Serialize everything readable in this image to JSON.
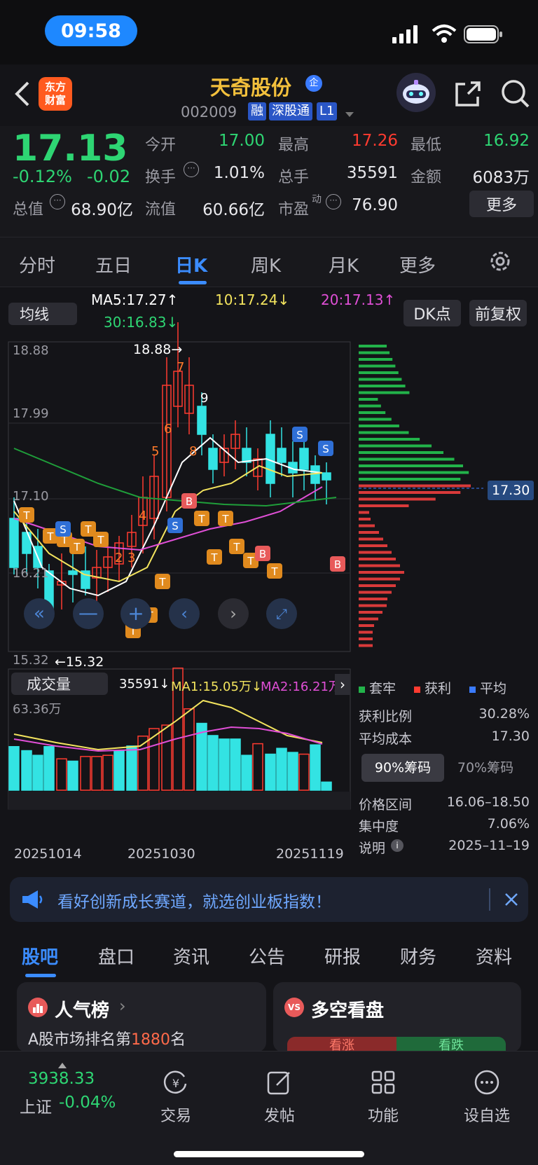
{
  "status": {
    "time": "09:58"
  },
  "header": {
    "name": "天奇股份",
    "code": "002009",
    "tags": [
      "融",
      "深股通",
      "L1"
    ],
    "name_badge": "企"
  },
  "quote": {
    "price": "17.13",
    "pct": "-0.12%",
    "chg": "-0.02",
    "open_label": "今开",
    "open": "17.00",
    "high_label": "最高",
    "high": "17.26",
    "low_label": "最低",
    "low": "16.92",
    "turnover_label": "换手",
    "turnover": "1.01%",
    "vol_label": "总手",
    "vol": "35591",
    "amt_label": "金额",
    "amt": "6083万",
    "mcap_label": "总值",
    "mcap": "68.90亿",
    "float_label": "流值",
    "float": "60.66亿",
    "pe_label": "市盈",
    "pe_sup": "动",
    "pe": "76.90",
    "more": "更多"
  },
  "period_tabs": [
    "分时",
    "五日",
    "日K",
    "周K",
    "月K",
    "更多"
  ],
  "period_active": 2,
  "ma": {
    "selector": "均线",
    "ma5": "MA5:17.27↑",
    "ma10": "10:17.24↓",
    "ma20": "20:17.13↑",
    "ma30": "30:16.83↓",
    "dk": "DK点",
    "fq": "前复权"
  },
  "kline": {
    "y_labels": [
      "18.88",
      "17.99",
      "17.10",
      "16.21",
      "15.32"
    ],
    "hi_marker": "18.88→",
    "lo_marker": "←15.32",
    "dk_b": "B",
    "dk_s": "S",
    "dk_t": "T",
    "seq_labels": [
      "2",
      "3",
      "4",
      "5",
      "6",
      "7",
      "8",
      "9"
    ]
  },
  "chip": {
    "price_tag": "17.30",
    "legend": [
      "套牢",
      "获利",
      "平均"
    ]
  },
  "volume": {
    "selector": "成交量",
    "value": "35591↓",
    "ma1": "MA1:15.05万↓",
    "ma2": "MA2:16.21万",
    "max": "63.36万",
    "dates": [
      "20251014",
      "20251030",
      "20251119"
    ]
  },
  "chip_stats": {
    "profit_ratio_label": "获利比例",
    "profit_ratio": "30.28%",
    "avg_cost_label": "平均成本",
    "avg_cost": "17.30",
    "tab_a": "90%筹码",
    "tab_b": "70%筹码",
    "range_label": "价格区间",
    "range": "16.06–18.50",
    "conc_label": "集中度",
    "conc": "7.06%",
    "note_label": "说明",
    "note": "2025–11–19"
  },
  "banner": {
    "text": "看好创新成长赛道，就选创业板指数！"
  },
  "content_tabs": [
    "股吧",
    "盘口",
    "资讯",
    "公告",
    "研报",
    "财务",
    "资料"
  ],
  "cards": {
    "left_title": "人气榜",
    "left_sub_a": "A股市场排名第",
    "left_rank": "1880",
    "left_sub_b": "名",
    "right_title": "多空看盘",
    "right_bull": "看涨",
    "right_bear": "看跌"
  },
  "bottom": {
    "index_value": "3938.33",
    "index_name": "上证",
    "index_chg": "-0.04%",
    "items": [
      "交易",
      "发帖",
      "功能",
      "设自选"
    ]
  },
  "colors": {
    "up": "#ff3b30",
    "down": "#33e3e3",
    "accent": "#1e88ff",
    "ma5": "#ffffff",
    "ma10": "#f3e45e",
    "ma20": "#e04fd6",
    "ma30": "#1f9e3a"
  }
}
